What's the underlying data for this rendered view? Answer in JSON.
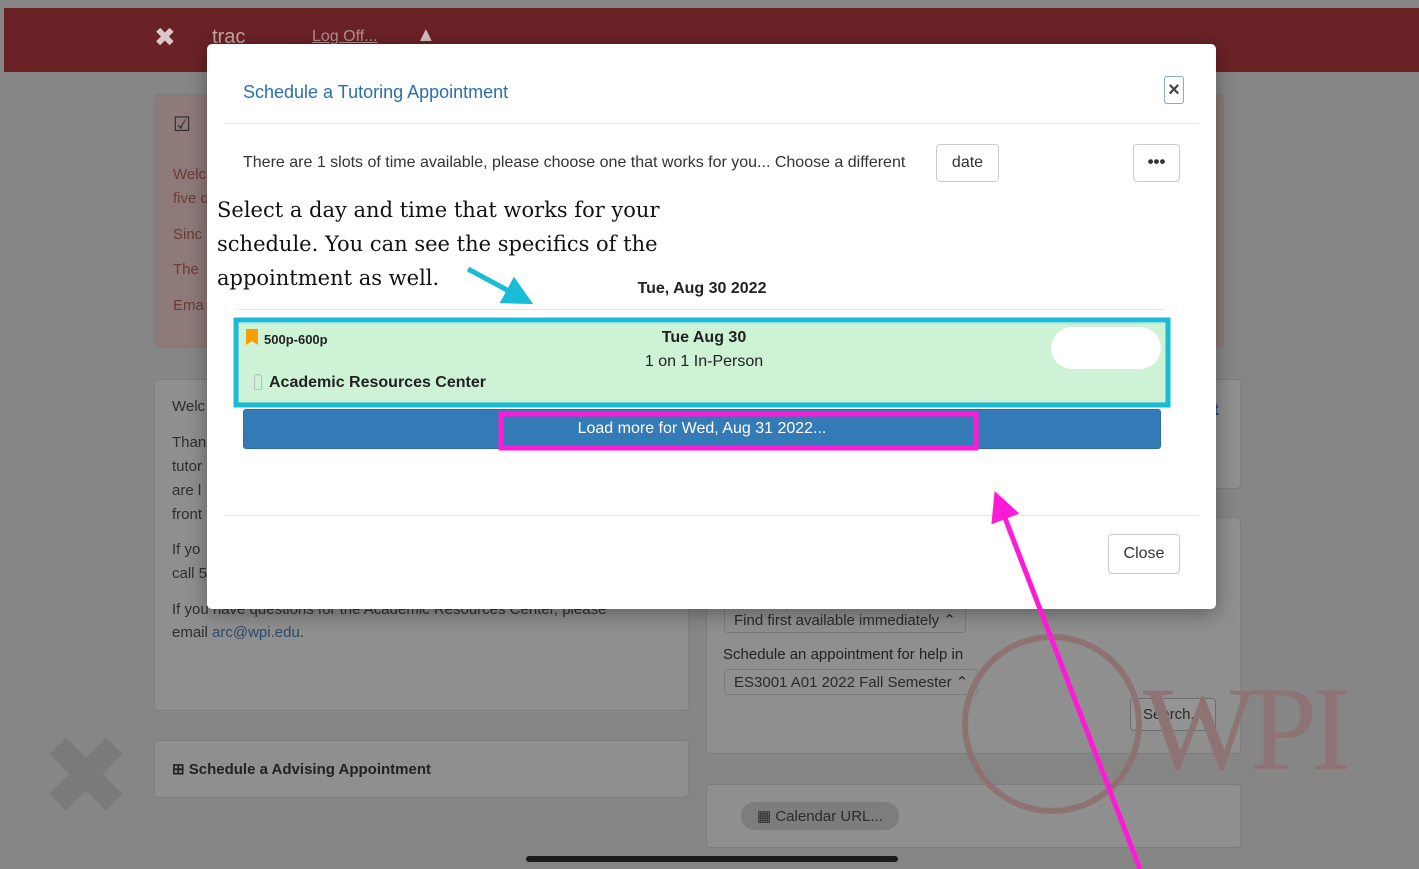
{
  "topbar": {
    "brand": "trac",
    "logoff": "Log Off..."
  },
  "background": {
    "welcome_lines": [
      "Welc",
      "five c",
      "Sinc",
      "The",
      "Ema"
    ],
    "card2_lines": [
      "Welc",
      "Than",
      "tutor",
      "are l",
      "front",
      "If yo",
      "call 5"
    ],
    "card2_footer": "If you have questions for the Academic Resources Center, please",
    "email_prefix": "email ",
    "email_link": "arc@wpi.edu",
    "email_suffix": ".",
    "find_first_select": "Find first available immediately ⌃",
    "schedule_help_label": "Schedule an appointment for help in",
    "course_select": "ES3001 A01 2022 Fall Semester   ⌃",
    "search_button": "Search...",
    "advising_title": "Schedule a Advising Appointment",
    "calendar_url_button": "Calendar URL...",
    "wpi_text": "WPI"
  },
  "modal": {
    "title": "Schedule a Tutoring Appointment",
    "close_x": "×",
    "availability_text": "There are 1 slots of time available, please choose one that works for you...  Choose a different",
    "date_button": "date",
    "more_button": "•••",
    "day_heading": "Tue, Aug 30 2022",
    "slot": {
      "time": "500p-600p",
      "date": "Tue Aug 30",
      "type": "1 on 1 In-Person",
      "location": "Academic Resources Center"
    },
    "load_more_button": "Load more for Wed, Aug 31 2022...",
    "close_button": "Close"
  },
  "annotation": {
    "callout_text": "Select a day and time that works for your\nschedule. You can see the specifics of the\nappointment as well.",
    "cyan_color": "#19bcd6",
    "magenta_color": "#ff1ad6"
  }
}
